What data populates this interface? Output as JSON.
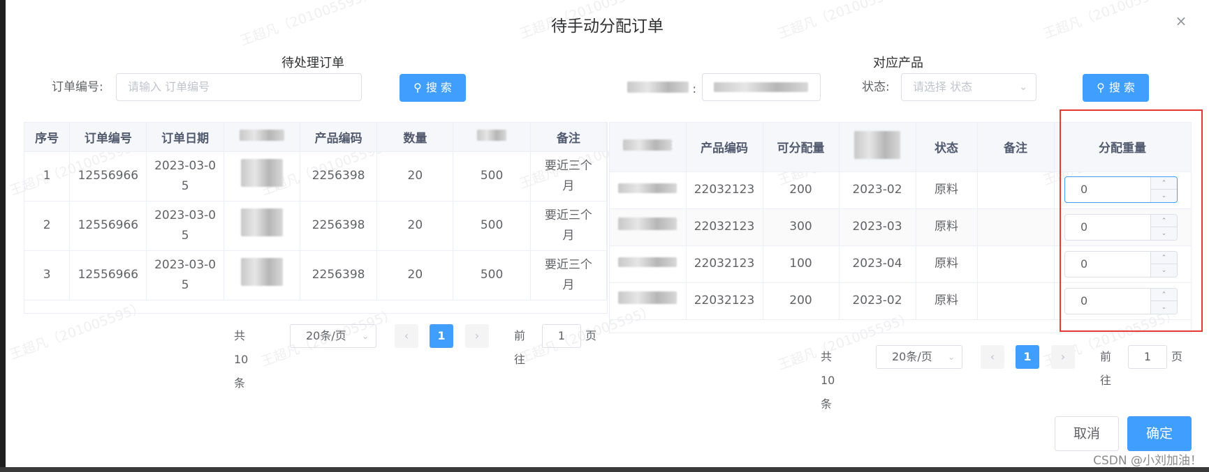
{
  "dialog": {
    "title": "待手动分配订单",
    "close_icon": "×"
  },
  "left": {
    "section_title": "待处理订单",
    "search": {
      "label": "订单编号:",
      "placeholder": "请输入 订单编号",
      "button": "搜 索"
    },
    "table": {
      "headers": [
        "序号",
        "订单编号",
        "订单日期",
        "",
        "产品编码",
        "数量",
        "",
        "备注"
      ],
      "rows": [
        {
          "idx": "1",
          "order_no": "12556966",
          "date_a": "2023-03-0",
          "date_b": "5",
          "code": "2256398",
          "qty": "20",
          "col7": "500",
          "remark_a": "要近三个",
          "remark_b": "月"
        },
        {
          "idx": "2",
          "order_no": "12556966",
          "date_a": "2023-03-0",
          "date_b": "5",
          "code": "2256398",
          "qty": "20",
          "col7": "500",
          "remark_a": "要近三个",
          "remark_b": "月"
        },
        {
          "idx": "3",
          "order_no": "12556966",
          "date_a": "2023-03-0",
          "date_b": "5",
          "code": "2256398",
          "qty": "20",
          "col7": "500",
          "remark_a": "要近三个",
          "remark_b": "月"
        }
      ]
    },
    "pager": {
      "total": "共 10 条",
      "size": "20条/页",
      "page": "1",
      "goto": "前往",
      "goto_value": "1",
      "page_unit": "页"
    }
  },
  "right": {
    "section_title": "对应产品",
    "filter": {
      "status_label": "状态:",
      "status_placeholder": "请选择 状态",
      "button": "搜 索"
    },
    "table": {
      "headers": [
        "",
        "产品编码",
        "可分配量",
        "",
        "状态",
        "备注",
        "分配重量"
      ],
      "rows": [
        {
          "code": "22032123",
          "avail": "200",
          "date": "2023-02",
          "status": "原料",
          "remark": "",
          "weight": "0"
        },
        {
          "code": "22032123",
          "avail": "300",
          "date": "2023-03",
          "status": "原料",
          "remark": "",
          "weight": "0"
        },
        {
          "code": "22032123",
          "avail": "100",
          "date": "2023-04",
          "status": "原料",
          "remark": "",
          "weight": "0"
        },
        {
          "code": "22032123",
          "avail": "200",
          "date": "2023-02",
          "status": "原料",
          "remark": "",
          "weight": "0"
        }
      ]
    },
    "pager": {
      "total": "共 10 条",
      "size": "20条/页",
      "page": "1",
      "goto": "前往",
      "goto_value": "1",
      "page_unit": "页"
    }
  },
  "footer": {
    "cancel": "取消",
    "confirm": "确定"
  },
  "watermark": "王超凡（201005595）",
  "credit": "CSDN @小刘加油！",
  "colors": {
    "primary": "#409eff",
    "highlight": "#e53935",
    "header_bg": "#f5f7fa"
  }
}
